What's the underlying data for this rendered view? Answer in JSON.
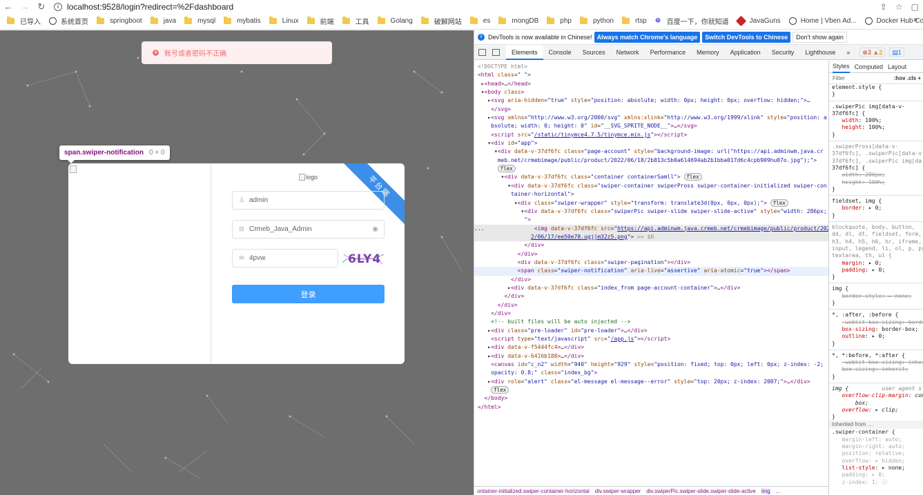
{
  "browser": {
    "url": "localhost:9528/login?redirect=%2Fdashboard",
    "bookmarks": [
      "已导入",
      "系统首页",
      "springboot",
      "java",
      "mysql",
      "mybatis",
      "Linux",
      "前端",
      "工具",
      "Golang",
      "破解网站",
      "es",
      "mongDB",
      "php",
      "python",
      "rtsp",
      "百度一下，你就知道",
      "JavaGuns",
      "Home | Vben Ad...",
      "Docker Hub Cont..."
    ],
    "more": "»"
  },
  "page": {
    "error_message": "账号或者密码不正确",
    "tooltip": {
      "selector": "span.swiper-notification",
      "size": "0 × 0"
    },
    "logo_alt": "logo",
    "ribbon": "平台端",
    "username": "admin",
    "password": "Crmeb_Java_Admin",
    "captcha_input": "4pvw",
    "captcha_text": "6LY4",
    "login_button": "登录"
  },
  "devtools": {
    "info": "DevTools is now available in Chinese!",
    "btn_match": "Always match Chrome's language",
    "btn_switch": "Switch DevTools to Chinese",
    "btn_dismiss": "Don't show again",
    "tabs": [
      "Elements",
      "Console",
      "Sources",
      "Network",
      "Performance",
      "Memory",
      "Application",
      "Security",
      "Lighthouse",
      "»"
    ],
    "errors": "3",
    "warnings": "2",
    "messages": "1",
    "styles_tabs": [
      "Styles",
      "Computed",
      "Layout"
    ],
    "filter_placeholder": "Filter",
    "filter_hov": ":hov .cls +",
    "breadcrumb": [
      "ontainer-initialized.swiper-container-horizontal",
      "div.swiper-wrapper",
      "div.swiperPic.swiper-slide.swiper-slide-active",
      "img",
      "..."
    ]
  }
}
